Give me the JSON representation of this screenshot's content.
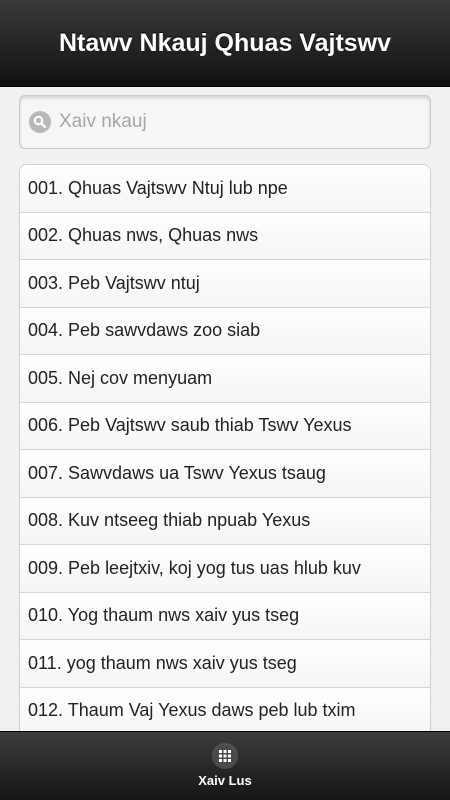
{
  "header": {
    "title": "Ntawv Nkauj Qhuas Vajtswv"
  },
  "search": {
    "placeholder": "Xaiv nkauj",
    "value": ""
  },
  "songs": [
    {
      "label": "001. Qhuas Vajtswv Ntuj lub npe"
    },
    {
      "label": "002. Qhuas nws, Qhuas nws"
    },
    {
      "label": "003. Peb Vajtswv ntuj"
    },
    {
      "label": "004. Peb sawvdaws zoo siab"
    },
    {
      "label": "005. Nej cov menyuam"
    },
    {
      "label": "006. Peb Vajtswv saub thiab Tswv Yexus"
    },
    {
      "label": "007. Sawvdaws ua Tswv Yexus tsaug"
    },
    {
      "label": "008. Kuv ntseeg thiab npuab Yexus"
    },
    {
      "label": "009. Peb leejtxiv, koj yog tus uas hlub kuv"
    },
    {
      "label": "010. Yog thaum nws xaiv yus tseg"
    },
    {
      "label": "011. yog thaum nws xaiv yus tseg"
    },
    {
      "label": "012. Thaum Vaj Yexus daws peb lub txim"
    }
  ],
  "footer": {
    "button_label": "Xaiv Lus",
    "icon": "grid-icon"
  }
}
